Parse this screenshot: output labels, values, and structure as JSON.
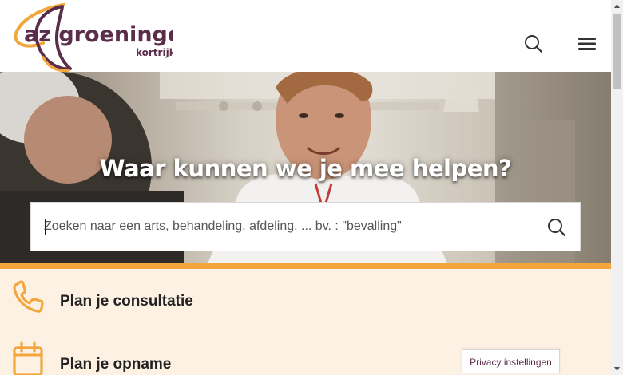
{
  "header": {
    "logo": {
      "brand": "az groeninge",
      "city": "kortrijk"
    },
    "search_icon": "search-icon",
    "menu_icon": "hamburger-menu-icon"
  },
  "hero": {
    "title": "Waar kunnen we je mee helpen?",
    "search": {
      "placeholder": "Zoeken naar een arts, behandeling, afdeling, ... bv. : \"bevalling\"",
      "value": ""
    }
  },
  "quick_links": [
    {
      "label": "Plan je consultatie",
      "icon": "phone-icon"
    },
    {
      "label": "Plan je opname",
      "icon": "calendar-icon"
    }
  ],
  "privacy_button": {
    "label": "Privacy instellingen"
  },
  "colors": {
    "brand_purple": "#5a2d4b",
    "brand_orange": "#f2a63c",
    "band_orange": "#f2a63c",
    "quick_bg": "#fdf1e4"
  }
}
